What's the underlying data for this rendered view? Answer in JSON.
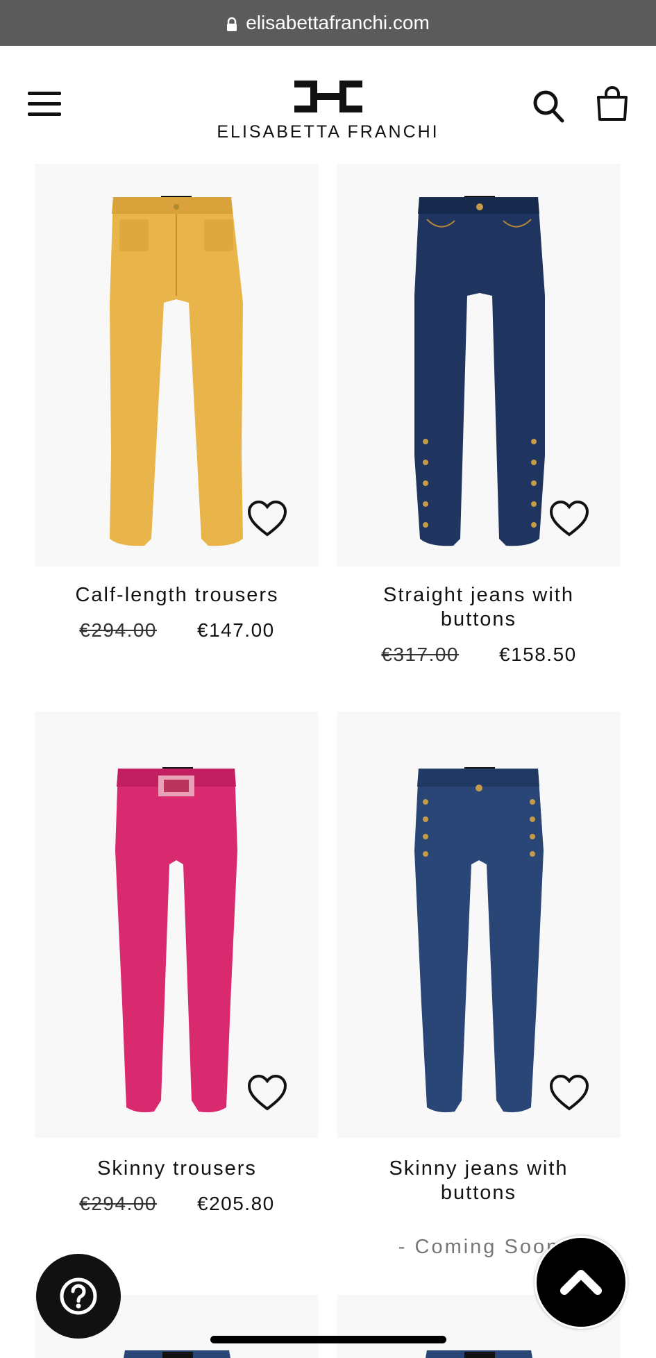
{
  "browser": {
    "url": "elisabettafranchi.com"
  },
  "header": {
    "brand": "ELISABETTA FRANCHI"
  },
  "products": [
    {
      "title": "Calf-length trousers",
      "old_price": "€294.00",
      "price": "€147.00",
      "color": "#e9b54a"
    },
    {
      "title": "Straight jeans with buttons",
      "old_price": "€317.00",
      "price": "€158.50",
      "color": "#1f3560"
    },
    {
      "title": "Skinny trousers",
      "old_price": "€294.00",
      "price": "€205.80",
      "color": "#d9296f"
    },
    {
      "title": "Skinny jeans with buttons",
      "status": "- Coming Soon"
    }
  ],
  "colors": {
    "urlbar": "#5b5b5b",
    "card_bg": "#f8f8f8",
    "text": "#111111"
  },
  "icons": [
    "lock-icon",
    "menu-icon",
    "brand-logo",
    "search-icon",
    "shopping-bag-icon",
    "heart-icon",
    "help-icon",
    "chevron-up-icon"
  ]
}
